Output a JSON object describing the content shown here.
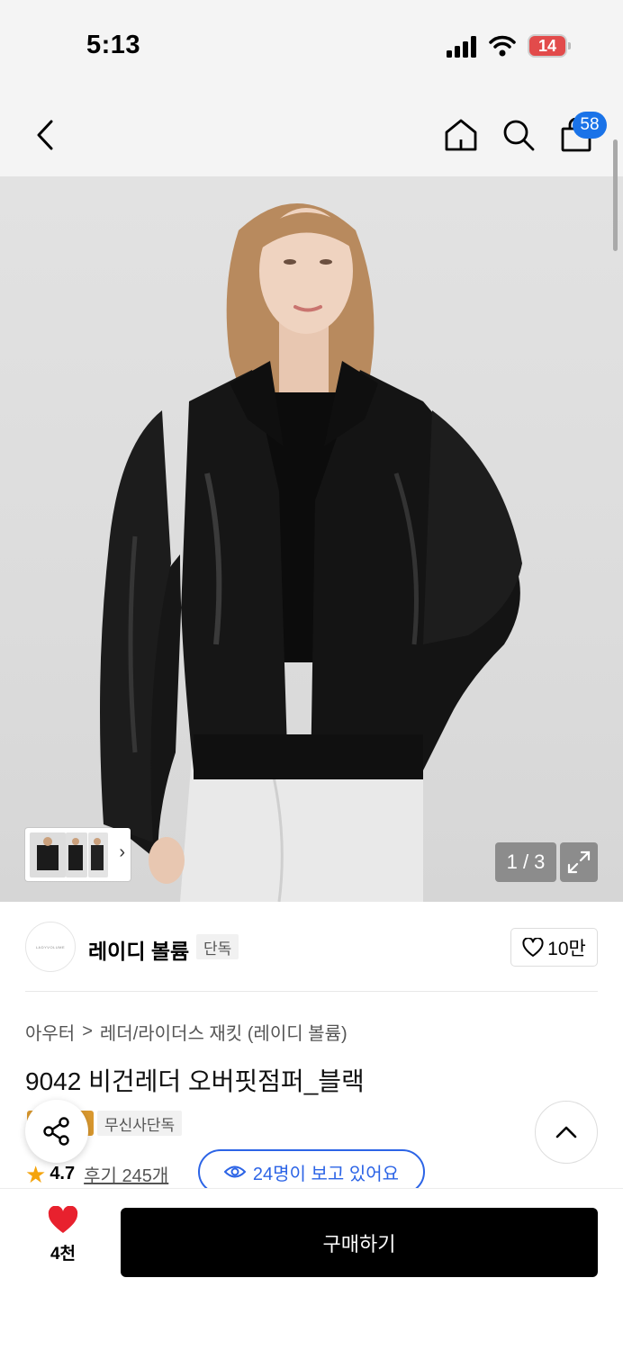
{
  "status_bar": {
    "time": "5:13",
    "battery": "14"
  },
  "nav": {
    "cart_count": "58"
  },
  "gallery": {
    "counter": "1 / 3"
  },
  "brand": {
    "name": "레이디 볼륨",
    "tag": "단독",
    "likes": "10만",
    "logo_text": "LADYVOLUME"
  },
  "breadcrumb": {
    "level1": "아우터",
    "separator": ">",
    "level2": "레더/라이더스 재킷 (레이디 볼륨)"
  },
  "product": {
    "title": "9042 비건레더 오버핏점퍼_블랙",
    "exclusive_badge": "무신사단독"
  },
  "rating": {
    "value": "4.7",
    "reviews": "후기 245개"
  },
  "viewers": {
    "text": "24명이 보고 있어요"
  },
  "bottom_bar": {
    "wish_count": "4천",
    "buy_label": "구매하기"
  },
  "colors": {
    "accent_blue": "#2c64e6",
    "badge_blue": "#1a73e8",
    "heart_red": "#e8212e",
    "star_orange": "#f4a40c",
    "battery_red": "#e24b4b"
  }
}
